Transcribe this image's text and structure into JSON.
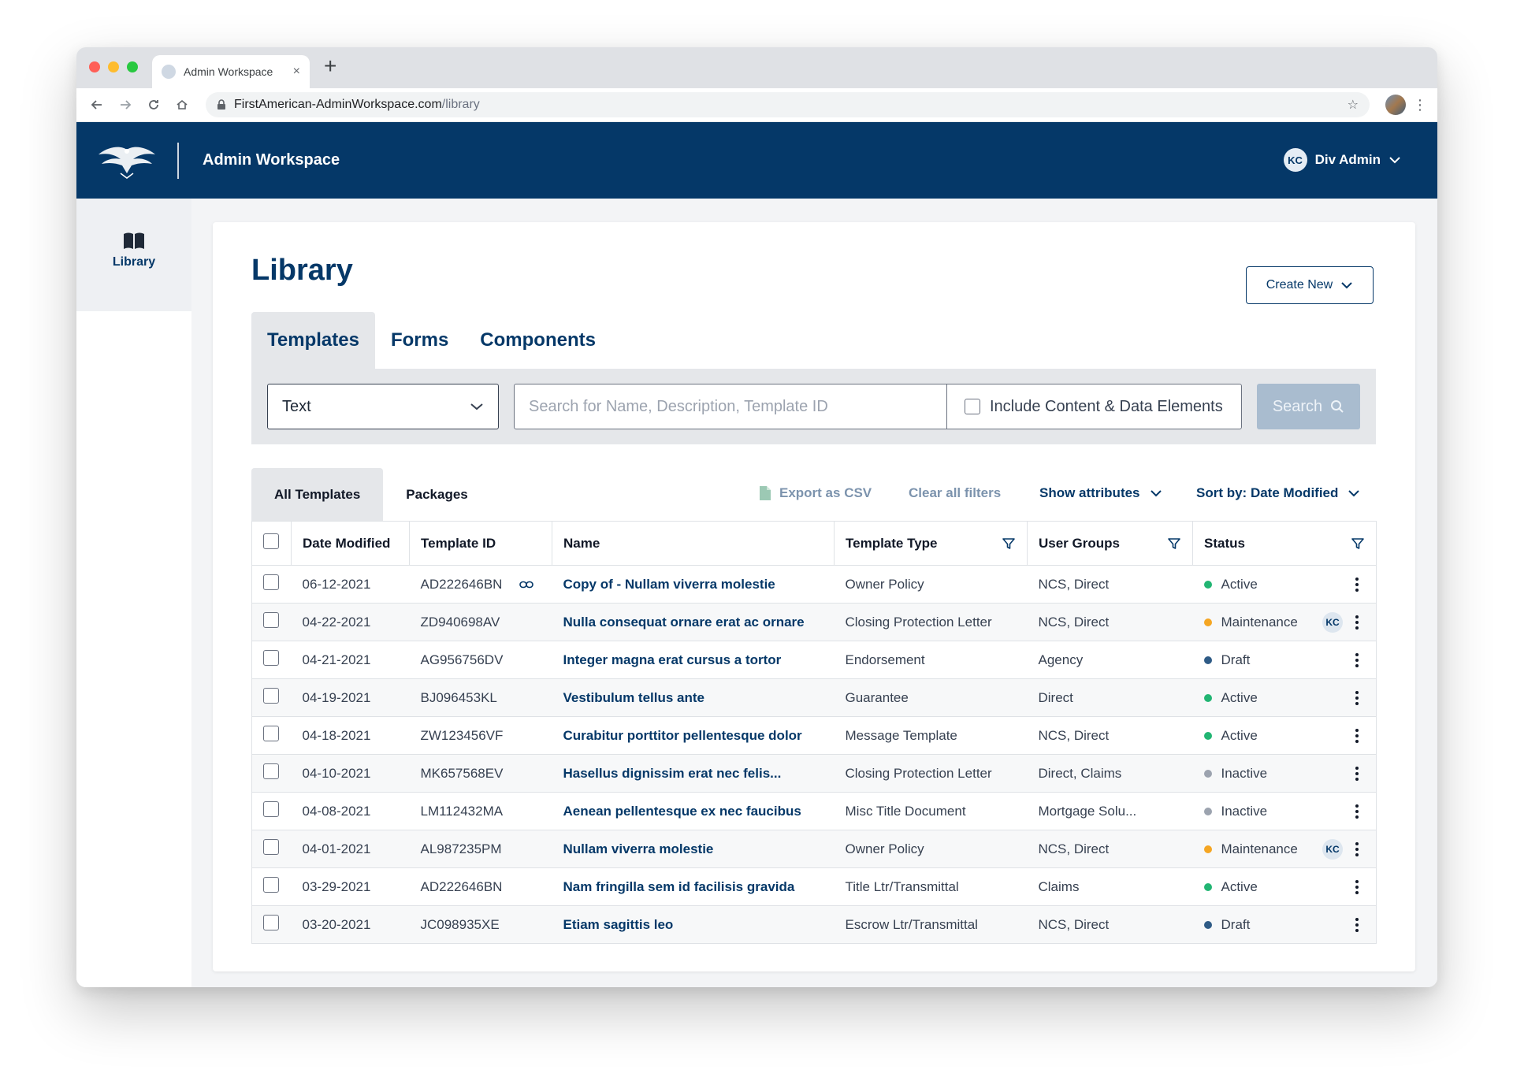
{
  "browser": {
    "tab_title": "Admin Workspace",
    "new_tab": "+",
    "tab_close": "×",
    "url_host": "FirstAmerican-AdminWorkspace.com",
    "url_path": "/library"
  },
  "header": {
    "app_title": "Admin Workspace",
    "user_initials": "KC",
    "user_name": "Div Admin"
  },
  "sidebar": {
    "library_label": "Library"
  },
  "page": {
    "title": "Library",
    "create_button": "Create New",
    "type_tabs": [
      "Templates",
      "Forms",
      "Components"
    ],
    "active_type_tab": "Templates"
  },
  "search": {
    "select_value": "Text",
    "placeholder": "Search for Name, Description, Template ID",
    "include_label": "Include Content & Data Elements",
    "button_label": "Search"
  },
  "list": {
    "tabs": [
      "All Templates",
      "Packages"
    ],
    "active_tab": "All Templates",
    "export_label": "Export as CSV",
    "clear_label": "Clear all filters",
    "show_attributes_label": "Show attributes",
    "sort_label": "Sort by: Date Modified"
  },
  "table": {
    "headers": {
      "date": "Date Modified",
      "id": "Template ID",
      "name": "Name",
      "type": "Template Type",
      "groups": "User Groups",
      "status": "Status"
    },
    "rows": [
      {
        "date": "06-12-2021",
        "id": "AD222646BN",
        "name": "Copy of - Nullam viverra molestie",
        "type": "Owner Policy",
        "groups": "NCS, Direct",
        "status": "Active"
      },
      {
        "date": "04-22-2021",
        "id": "ZD940698AV",
        "name": "Nulla consequat ornare erat ac ornare",
        "type": "Closing Protection Letter",
        "groups": "NCS, Direct",
        "status": "Maintenance",
        "badge": "KC"
      },
      {
        "date": "04-21-2021",
        "id": "AG956756DV",
        "name": "Integer magna erat cursus a tortor",
        "type": "Endorsement",
        "groups": "Agency",
        "status": "Draft"
      },
      {
        "date": "04-19-2021",
        "id": "BJ096453KL",
        "name": "Vestibulum tellus ante",
        "type": "Guarantee",
        "groups": "Direct",
        "status": "Active"
      },
      {
        "date": "04-18-2021",
        "id": "ZW123456VF",
        "name": "Curabitur porttitor pellentesque dolor",
        "type": "Message Template",
        "groups": "NCS, Direct",
        "status": "Active"
      },
      {
        "date": "04-10-2021",
        "id": "MK657568EV",
        "name": "Hasellus dignissim erat nec felis...",
        "type": "Closing Protection Letter",
        "groups": "Direct, Claims",
        "status": "Inactive"
      },
      {
        "date": "04-08-2021",
        "id": "LM112432MA",
        "name": "Aenean pellentesque ex nec faucibus",
        "type": "Misc Title Document",
        "groups": "Mortgage Solu...",
        "status": "Inactive"
      },
      {
        "date": "04-01-2021",
        "id": "AL987235PM",
        "name": "Nullam viverra molestie",
        "type": "Owner Policy",
        "groups": "NCS, Direct",
        "status": "Maintenance",
        "badge": "KC"
      },
      {
        "date": "03-29-2021",
        "id": "AD222646BN",
        "name": "Nam fringilla sem id facilisis gravida",
        "type": "Title Ltr/Transmittal",
        "groups": "Claims",
        "status": "Active"
      },
      {
        "date": "03-20-2021",
        "id": "JC098935XE",
        "name": "Etiam sagittis leo",
        "type": "Escrow Ltr/Transmittal",
        "groups": "NCS, Direct",
        "status": "Draft"
      }
    ]
  },
  "status_colors": {
    "Active": "#22b573",
    "Maintenance": "#f5a623",
    "Draft": "#2f5b86",
    "Inactive": "#9ca3af"
  },
  "colors": {
    "brand": "#053868",
    "muted_link": "#7c93ad",
    "search_button": "#a9bccf"
  },
  "icons": {
    "sidebar": "book-icon",
    "export": "csv-file-icon",
    "row_link": "link-icon",
    "filter": "funnel-icon",
    "row_menu": "kebab-icon"
  }
}
